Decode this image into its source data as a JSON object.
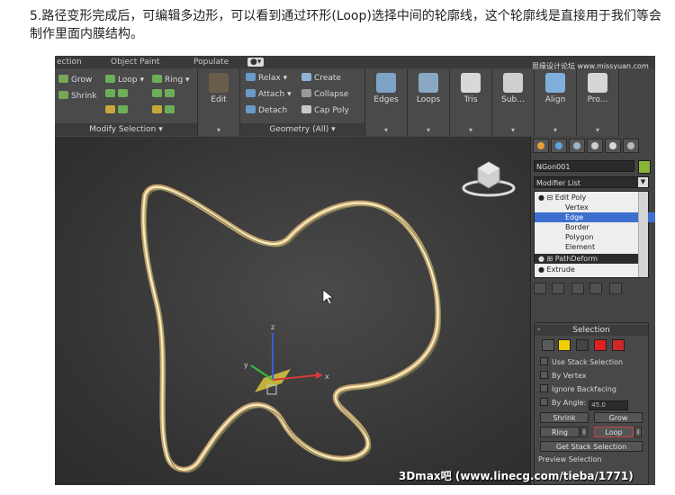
{
  "caption": "5.路径变形完成后，可编辑多边形，可以看到通过环形(Loop)选择中间的轮廓线，这个轮廓线是直接用于我们等会制作里面内膜结构。",
  "ribbon": {
    "tabs": [
      "ection",
      "Object Paint",
      "Populate"
    ],
    "modify_selection": {
      "grow": "Grow",
      "shrink": "Shrink",
      "loop": "Loop",
      "ring": "Ring",
      "label": "Modify Selection"
    },
    "edit": "Edit",
    "geometry": {
      "relax": "Relax",
      "create": "Create",
      "attach": "Attach",
      "collapse": "Collapse",
      "detach": "Detach",
      "cap_poly": "Cap Poly",
      "label": "Geometry (All)"
    },
    "tools": [
      "Edges",
      "Loops",
      "Tris",
      "Sub...",
      "Align",
      "Pro..."
    ],
    "watermark_top": "思缘设计论坛  www.missyuan.com"
  },
  "panel": {
    "object_name": "NGon001",
    "modifier_list": "Modifier List",
    "stack": [
      {
        "label": "Edit Poly",
        "level": 0,
        "selected": false
      },
      {
        "label": "Vertex",
        "level": 1,
        "selected": false
      },
      {
        "label": "Edge",
        "level": 1,
        "selected": true
      },
      {
        "label": "Border",
        "level": 1,
        "selected": false
      },
      {
        "label": "Polygon",
        "level": 1,
        "selected": false
      },
      {
        "label": "Element",
        "level": 1,
        "selected": false
      },
      {
        "label": "PathDeform",
        "level": 0,
        "selected": false
      },
      {
        "label": "Extrude",
        "level": 0,
        "selected": false
      }
    ],
    "selection": {
      "title": "Selection",
      "use_stack_selection": "Use Stack Selection",
      "by_vertex": "By Vertex",
      "ignore_backfacing": "Ignore Backfacing",
      "by_angle": "By Angle:",
      "angle_value": "45.0",
      "shrink": "Shrink",
      "grow": "Grow",
      "ring": "Ring",
      "loop": "Loop",
      "get_stack_selection": "Get Stack Selection",
      "preview_selection": "Preview Selection"
    }
  },
  "viewport": {
    "axis_x": "x",
    "axis_y": "y",
    "axis_z": "z"
  },
  "watermark": "3Dmax吧  (www.linecg.com/tieba/1771)",
  "colors": {
    "selected_edge": "#f2f2c8",
    "edge_outline": "#c9a06a",
    "stack_highlight": "#3d6fcf",
    "loop_border": "#c84040"
  }
}
